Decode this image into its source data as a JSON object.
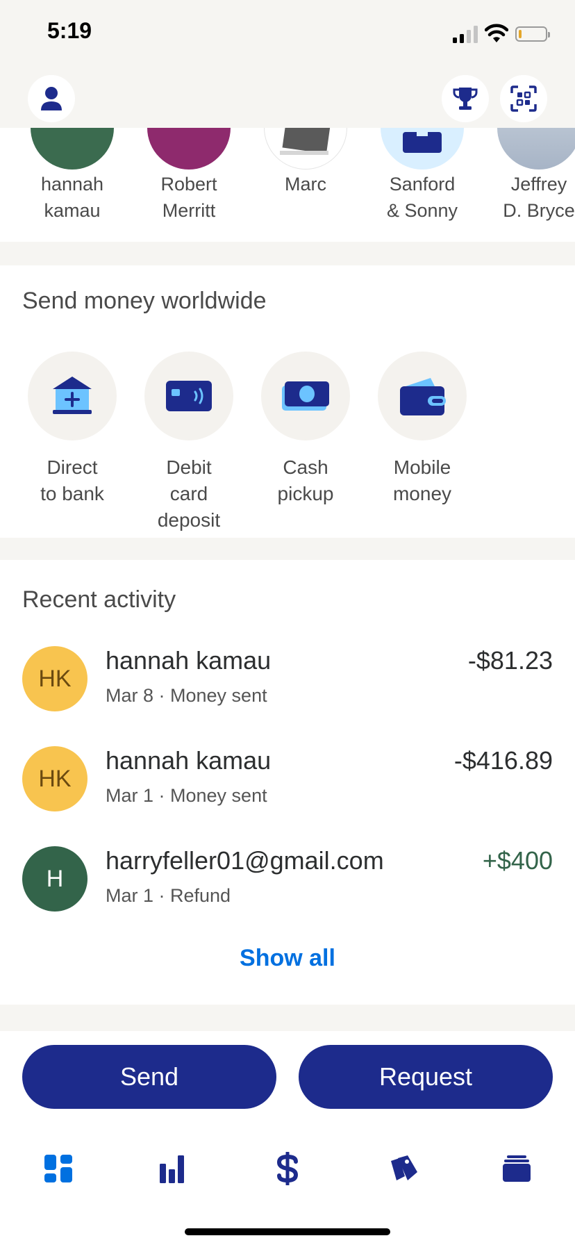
{
  "status_bar": {
    "time": "5:19"
  },
  "contacts": [
    {
      "name": "hannah\nkamau",
      "avatar_color": "#3b6b4f"
    },
    {
      "name": "Robert\nMerritt",
      "avatar_color": "#8e2a6d"
    },
    {
      "name": "Marc",
      "avatar_color": "#ffffff"
    },
    {
      "name": "Sanford\n& Sonny",
      "avatar_color": "#d9efff"
    },
    {
      "name": "Jeffrey\nD. Bryce",
      "avatar_color": "#b9c4d3"
    }
  ],
  "send_money": {
    "title": "Send money worldwide",
    "methods": [
      {
        "label": "Direct\nto bank",
        "icon": "bank-icon"
      },
      {
        "label": "Debit\ncard\ndeposit",
        "icon": "debit-card-icon"
      },
      {
        "label": "Cash\npickup",
        "icon": "cash-icon"
      },
      {
        "label": "Mobile\nmoney",
        "icon": "wallet-icon"
      }
    ]
  },
  "recent_activity": {
    "title": "Recent activity",
    "items": [
      {
        "initials": "HK",
        "name": "hannah kamau",
        "detail": "Mar 8 · Money sent",
        "amount": "-$81.23",
        "avatar_color": "#f8c44f",
        "initials_color": "#6b4a10",
        "amount_color": "#2c2e2f"
      },
      {
        "initials": "HK",
        "name": "hannah kamau",
        "detail": "Mar 1 · Money sent",
        "amount": "-$416.89",
        "avatar_color": "#f8c44f",
        "initials_color": "#6b4a10",
        "amount_color": "#2c2e2f"
      },
      {
        "initials": "H",
        "name": "harryfeller01@gmail.com",
        "detail": "Mar 1 · Refund",
        "amount": "+$400",
        "avatar_color": "#33644a",
        "initials_color": "#ffffff",
        "amount_color": "#33644a"
      }
    ],
    "show_all": "Show all"
  },
  "actions": {
    "send": "Send",
    "request": "Request"
  },
  "nav": [
    {
      "name": "home-nav-icon",
      "active": true
    },
    {
      "name": "insights-nav-icon",
      "active": false
    },
    {
      "name": "dollar-nav-icon",
      "active": false
    },
    {
      "name": "offers-nav-icon",
      "active": false
    },
    {
      "name": "wallet-nav-icon",
      "active": false
    }
  ],
  "colors": {
    "brand": "#1d2b8c",
    "link": "#0070e0",
    "positive": "#33644a"
  }
}
